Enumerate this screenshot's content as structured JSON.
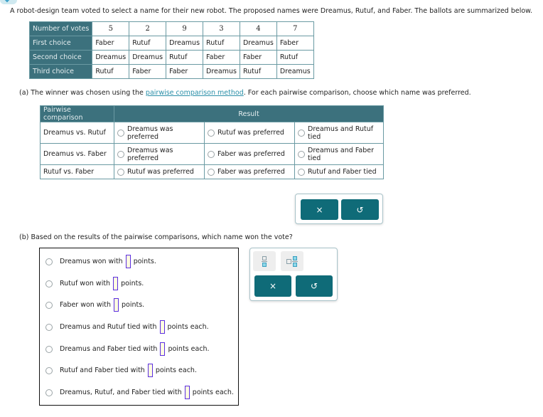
{
  "intro_text": "A robot-design team voted to select a name for their new robot. The proposed names were Dreamus, Rutuf, and Faber. The ballots are summarized below.",
  "ballot_table": {
    "row_headers": [
      "Number of votes",
      "First choice",
      "Second choice",
      "Third choice"
    ],
    "votes": [
      "5",
      "2",
      "9",
      "3",
      "4",
      "7"
    ],
    "first_choice": [
      "Faber",
      "Rutuf",
      "Dreamus",
      "Rutuf",
      "Dreamus",
      "Faber"
    ],
    "second_choice": [
      "Dreamus",
      "Dreamus",
      "Rutuf",
      "Faber",
      "Faber",
      "Rutuf"
    ],
    "third_choice": [
      "Rutuf",
      "Faber",
      "Faber",
      "Dreamus",
      "Rutuf",
      "Dreamus"
    ]
  },
  "part_a": {
    "prefix": "(a) The winner was chosen using the ",
    "link_text": "pairwise comparison method",
    "suffix": ". For each pairwise comparison, choose which name was preferred.",
    "table": {
      "header_comparison": "Pairwise comparison",
      "header_result": "Result",
      "rows": [
        {
          "label": "Dreamus vs. Rutuf",
          "options": [
            "Dreamus was preferred",
            "Rutuf was preferred",
            "Dreamus and Rutuf tied"
          ]
        },
        {
          "label": "Dreamus vs. Faber",
          "options": [
            "Dreamus was preferred",
            "Faber was preferred",
            "Dreamus and Faber tied"
          ]
        },
        {
          "label": "Rutuf vs. Faber",
          "options": [
            "Rutuf was preferred",
            "Faber was preferred",
            "Rutuf and Faber tied"
          ]
        }
      ]
    },
    "toolbox": {
      "clear_icon": "×",
      "undo_icon": "↺"
    }
  },
  "part_b": {
    "question": "(b) Based on the results of the pairwise comparisons, which name won the vote?",
    "options": [
      {
        "before": "Dreamus won with",
        "after": "points."
      },
      {
        "before": "Rutuf won with",
        "after": "points."
      },
      {
        "before": "Faber won with",
        "after": "points."
      },
      {
        "before": "Dreamus and Rutuf tied with",
        "after": "points each."
      },
      {
        "before": "Dreamus and Faber tied with",
        "after": "points each."
      },
      {
        "before": "Rutuf and Faber tied with",
        "after": "points each."
      },
      {
        "before": "Dreamus, Rutuf, and Faber tied with",
        "after": "points each."
      }
    ],
    "toolbox": {
      "clear_icon": "×",
      "undo_icon": "↺"
    }
  }
}
